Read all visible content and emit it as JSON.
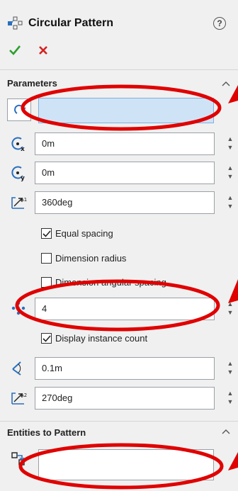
{
  "header": {
    "title": "Circular Pattern",
    "help_label": "?"
  },
  "sections": {
    "parameters": {
      "title": "Parameters"
    },
    "entities": {
      "title": "Entities to Pattern"
    }
  },
  "fields": {
    "axis_x": {
      "value": "0m"
    },
    "axis_y": {
      "value": "0m"
    },
    "angle": {
      "value": "360deg"
    },
    "instances": {
      "value": "4"
    },
    "radius": {
      "value": "0.1m"
    },
    "angle2": {
      "value": "270deg"
    }
  },
  "checkboxes": {
    "equal_spacing": {
      "label": "Equal spacing",
      "checked": true
    },
    "dimension_radius": {
      "label": "Dimension radius",
      "checked": false
    },
    "dimension_angular_spacing": {
      "label": "Dimension angular spacing",
      "checked": false
    },
    "display_instance_count": {
      "label": "Display instance count",
      "checked": true
    }
  },
  "colors": {
    "annotation_red": "#e00000",
    "ok_green": "#2e9e2e",
    "cancel_red": "#d62020",
    "selection_blue": "#cfe3f7"
  },
  "icons": [
    "pattern-icon",
    "help-icon",
    "ok-check-icon",
    "cancel-x-icon",
    "collapse-chevron-icon",
    "select-direction-icon",
    "axis-x-icon",
    "axis-y-icon",
    "angle-icon",
    "instances-icon",
    "radius-icon",
    "angle2-icon",
    "entities-icon"
  ]
}
